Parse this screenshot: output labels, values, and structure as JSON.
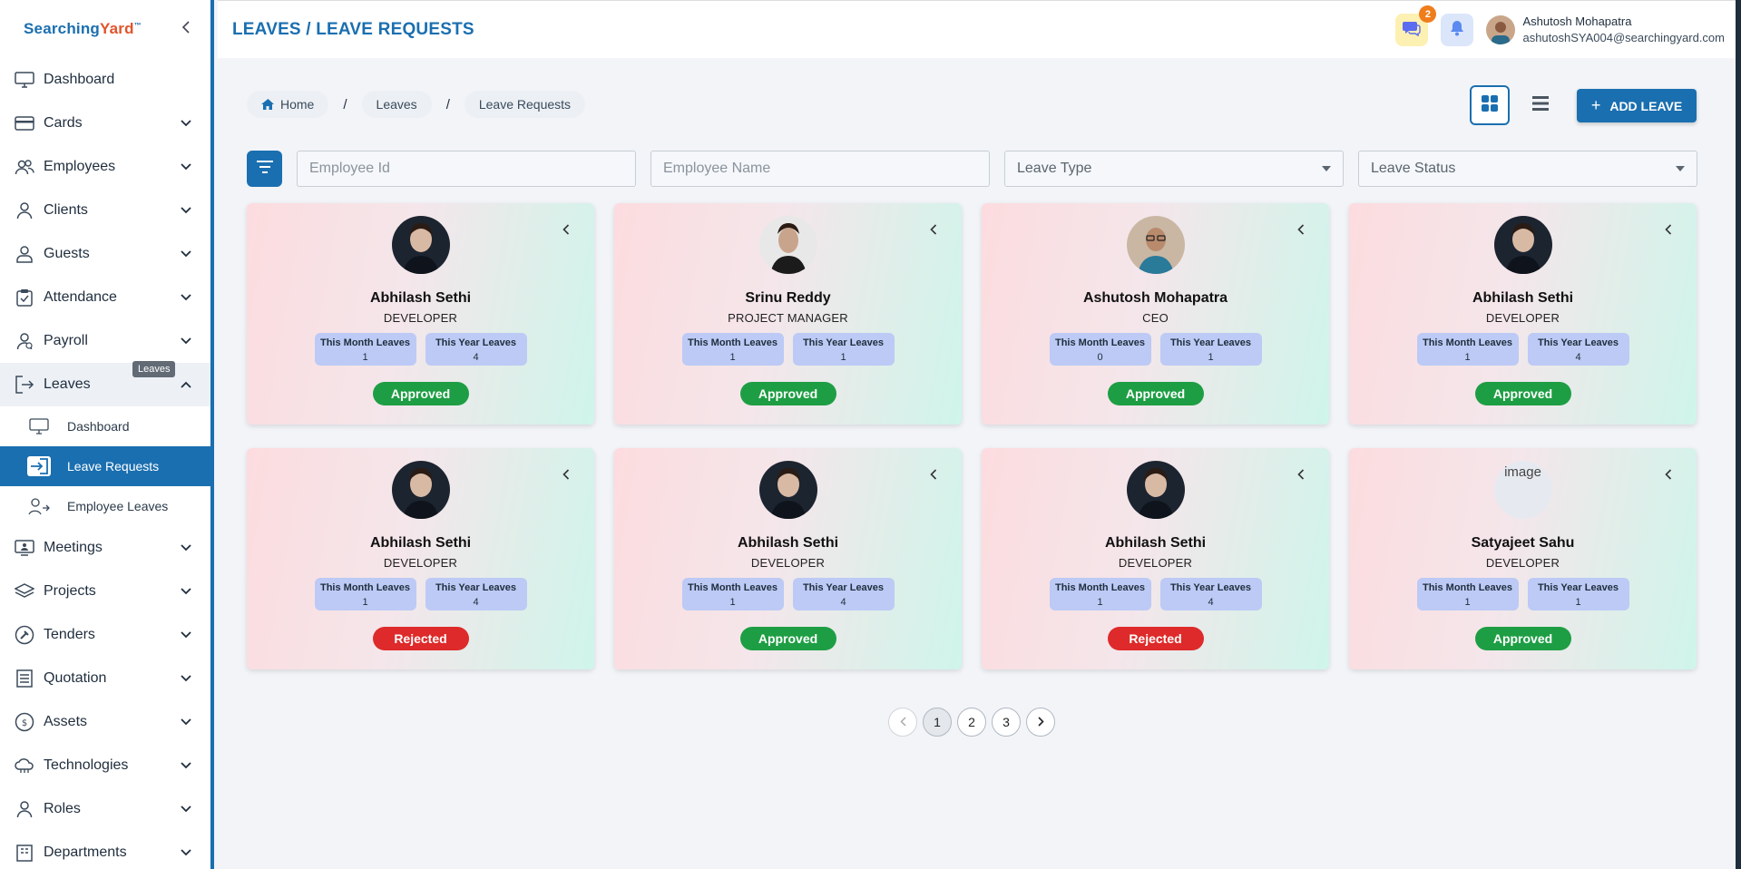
{
  "brand": {
    "part1": "Searching",
    "part2": "Yard",
    "tm": "™"
  },
  "sidebar": {
    "items": [
      {
        "label": "Dashboard",
        "icon": "monitor-icon"
      },
      {
        "label": "Cards",
        "icon": "card-icon"
      },
      {
        "label": "Employees",
        "icon": "users-icon"
      },
      {
        "label": "Clients",
        "icon": "user-icon"
      },
      {
        "label": "Guests",
        "icon": "guest-icon"
      },
      {
        "label": "Attendance",
        "icon": "clipboard-icon"
      },
      {
        "label": "Payroll",
        "icon": "payroll-icon"
      },
      {
        "label": "Leaves",
        "icon": "leave-icon"
      },
      {
        "label": "Meetings",
        "icon": "meeting-icon"
      },
      {
        "label": "Projects",
        "icon": "layers-icon"
      },
      {
        "label": "Tenders",
        "icon": "tender-icon"
      },
      {
        "label": "Quotation",
        "icon": "list-icon"
      },
      {
        "label": "Assets",
        "icon": "assets-icon"
      },
      {
        "label": "Technologies",
        "icon": "cloud-icon"
      },
      {
        "label": "Roles",
        "icon": "role-icon"
      },
      {
        "label": "Departments",
        "icon": "department-icon"
      }
    ],
    "leaves_sub": [
      {
        "label": "Dashboard"
      },
      {
        "label": "Leave Requests"
      },
      {
        "label": "Employee Leaves"
      }
    ],
    "tooltip": "Leaves"
  },
  "header": {
    "title": "LEAVES / LEAVE REQUESTS",
    "chat_badge": "2",
    "user_name": "Ashutosh Mohapatra",
    "user_email": "ashutoshSYA004@searchingyard.com"
  },
  "breadcrumb": {
    "home": "Home",
    "leaves": "Leaves",
    "current": "Leave Requests",
    "sep": "/"
  },
  "toolbar": {
    "add_label": "ADD LEAVE"
  },
  "filters": {
    "employee_id_placeholder": "Employee Id",
    "employee_name_placeholder": "Employee Name",
    "leave_type": "Leave Type",
    "leave_status": "Leave Status"
  },
  "labels": {
    "month": "This Month Leaves",
    "year": "This Year Leaves",
    "broken_image": "image"
  },
  "cards": [
    {
      "name": "Abhilash Sethi",
      "role": "DEVELOPER",
      "month": "1",
      "year": "4",
      "status": "Approved",
      "photo": "dark"
    },
    {
      "name": "Srinu Reddy",
      "role": "PROJECT MANAGER",
      "month": "1",
      "year": "1",
      "status": "Approved",
      "photo": "light"
    },
    {
      "name": "Ashutosh Mohapatra",
      "role": "CEO",
      "month": "0",
      "year": "1",
      "status": "Approved",
      "photo": "warm"
    },
    {
      "name": "Abhilash Sethi",
      "role": "DEVELOPER",
      "month": "1",
      "year": "4",
      "status": "Approved",
      "photo": "dark"
    },
    {
      "name": "Abhilash Sethi",
      "role": "DEVELOPER",
      "month": "1",
      "year": "4",
      "status": "Rejected",
      "photo": "dark"
    },
    {
      "name": "Abhilash Sethi",
      "role": "DEVELOPER",
      "month": "1",
      "year": "4",
      "status": "Approved",
      "photo": "dark"
    },
    {
      "name": "Abhilash Sethi",
      "role": "DEVELOPER",
      "month": "1",
      "year": "4",
      "status": "Rejected",
      "photo": "dark"
    },
    {
      "name": "Satyajeet Sahu",
      "role": "DEVELOPER",
      "month": "1",
      "year": "1",
      "status": "Approved",
      "photo": "broken"
    }
  ],
  "pagination": {
    "pages": [
      "1",
      "2",
      "3"
    ],
    "current": "1"
  },
  "colors": {
    "primary": "#1a6fb0",
    "approved": "#1e9e44",
    "rejected": "#de2a2a",
    "stat_bg": "#bccaf5",
    "brand_accent": "#e0542b"
  }
}
